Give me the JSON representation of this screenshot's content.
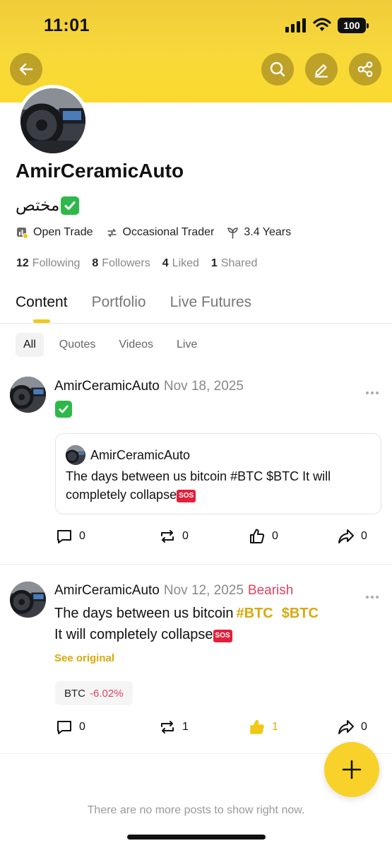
{
  "status_bar": {
    "time": "11:01",
    "battery": "100"
  },
  "toolbar": {
    "back_icon": "arrow-left-icon",
    "search_icon": "search-icon",
    "edit_icon": "pencil-icon",
    "share_icon": "share-icon"
  },
  "profile": {
    "name": "AmirCeramicAuto",
    "bio_text": "مختص",
    "bio_emoji": "✅",
    "badges": [
      {
        "icon": "open-trade-icon",
        "label": "Open Trade"
      },
      {
        "icon": "occasional-trader-icon",
        "label": "Occasional Trader"
      },
      {
        "icon": "sprout-icon",
        "label": "3.4 Years"
      }
    ],
    "stats": [
      {
        "count": "12",
        "label": "Following"
      },
      {
        "count": "8",
        "label": "Followers"
      },
      {
        "count": "4",
        "label": "Liked"
      },
      {
        "count": "1",
        "label": "Shared"
      }
    ]
  },
  "tabs": [
    {
      "label": "Content",
      "active": true
    },
    {
      "label": "Portfolio",
      "active": false
    },
    {
      "label": "Live Futures",
      "active": false
    }
  ],
  "filters": [
    {
      "label": "All",
      "active": true
    },
    {
      "label": "Quotes",
      "active": false
    },
    {
      "label": "Videos",
      "active": false
    },
    {
      "label": "Live",
      "active": false
    }
  ],
  "posts": [
    {
      "author": "AmirCeramicAuto",
      "date": "Nov 18, 2025",
      "emoji": "✅",
      "quote": {
        "author": "AmirCeramicAuto",
        "text_line1": "The days between us bitcoin #BTC $BTC It will",
        "text_line2": "completely collapse",
        "sos": "SOS"
      },
      "actions": {
        "comments": "0",
        "reposts": "0",
        "likes": "0",
        "shares": "0"
      }
    },
    {
      "author": "AmirCeramicAuto",
      "date": "Nov 12, 2025",
      "sentiment": "Bearish",
      "body_line1": "The days between us bitcoin",
      "tag1": "#BTC",
      "tag2": "$BTC",
      "body_line2": "It will completely collapse",
      "sos": "SOS",
      "see_original": "See original",
      "ticker": {
        "symbol": "BTC",
        "change": "-6.02%"
      },
      "actions": {
        "comments": "0",
        "reposts": "1",
        "likes": "1",
        "shares": "0"
      }
    }
  ],
  "fab_icon": "plus-icon",
  "end_message": "There are no more posts to show right now.",
  "colors": {
    "brand_yellow": "#f8d22a",
    "accent_gold": "#d9a90b",
    "bearish_red": "#e0425e"
  }
}
